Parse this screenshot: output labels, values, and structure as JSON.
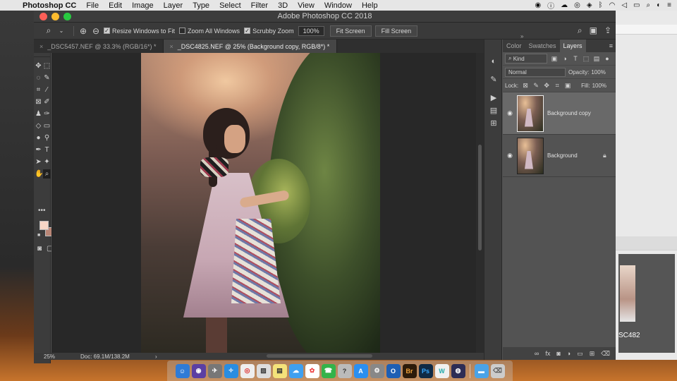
{
  "menubar": {
    "app_name": "Photoshop CC",
    "items": [
      "File",
      "Edit",
      "Image",
      "Layer",
      "Type",
      "Select",
      "Filter",
      "3D",
      "View",
      "Window",
      "Help"
    ]
  },
  "window": {
    "title": "Adobe Photoshop CC 2018"
  },
  "options": {
    "resize_windows": "Resize Windows to Fit",
    "zoom_all": "Zoom All Windows",
    "scrubby": "Scrubby Zoom",
    "zoom_value": "100%",
    "fit_screen": "Fit Screen",
    "fill_screen": "Fill Screen"
  },
  "doc_tabs": [
    {
      "label": "_DSC5457.NEF @ 33.3% (RGB/16*) *"
    },
    {
      "label": "_DSC4825.NEF @ 25% (Background copy, RGB/8*) *"
    }
  ],
  "status": {
    "zoom": "25%",
    "doc": "Doc: 69.1M/138.2M",
    "arrow": "›"
  },
  "panels": {
    "tabs": [
      "Color",
      "Swatches",
      "Layers"
    ],
    "kind_label": "Kind",
    "blend_mode": "Normal",
    "opacity_label": "Opacity:",
    "opacity_value": "100%",
    "lock_label": "Lock:",
    "fill_label": "Fill:",
    "fill_value": "100%",
    "layers": [
      {
        "name": "Background copy",
        "selected": true
      },
      {
        "name": "Background",
        "selected": false
      }
    ]
  },
  "peek_label": "SC482",
  "colors": {
    "foreground": "#f6d6c6",
    "background": "#b98575"
  }
}
